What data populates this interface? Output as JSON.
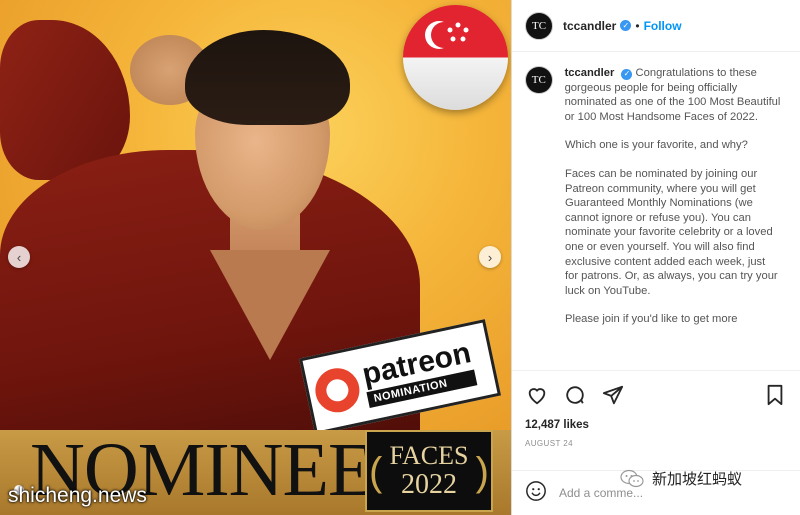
{
  "post": {
    "badge_brand": "patreon",
    "badge_sub": "NOMINATION",
    "banner_text": "NOMINEE",
    "faces_label": "FACES",
    "faces_year": "2022",
    "watermark": "shicheng.news"
  },
  "header": {
    "username": "tccandler",
    "separator": "•",
    "follow_label": "Follow",
    "avatar_text": "TC"
  },
  "caption": {
    "username": "tccandler",
    "line1": "Congratulations to these gorgeous people for being officially nominated as one of the 100 Most Beautiful or 100 Most Handsome Faces of 2022.",
    "para2": "Which one is your favorite, and why?",
    "para3": "Faces can be nominated by joining our Patreon community, where you will get Guaranteed Monthly Nominations (we cannot ignore or refuse you).  You can nominate your favorite celebrity or a loved one or even yourself.  You will also find exclusive content added each week, just for patrons.  Or, as always, you can try your luck on YouTube.",
    "para4": "Please join if you'd like to get more"
  },
  "actions": {
    "icons": [
      "heart-icon",
      "comment-icon",
      "share-icon",
      "bookmark-icon"
    ]
  },
  "likes": "12,487 likes",
  "date": "AUGUST 24",
  "comment": {
    "placeholder": "Add a comme..."
  },
  "wechat": {
    "label": "新加坡红蚂蚁"
  },
  "colors": {
    "follow_blue": "#0095f6",
    "verified_blue": "#3897f0",
    "patreon_red": "#e8432d"
  }
}
